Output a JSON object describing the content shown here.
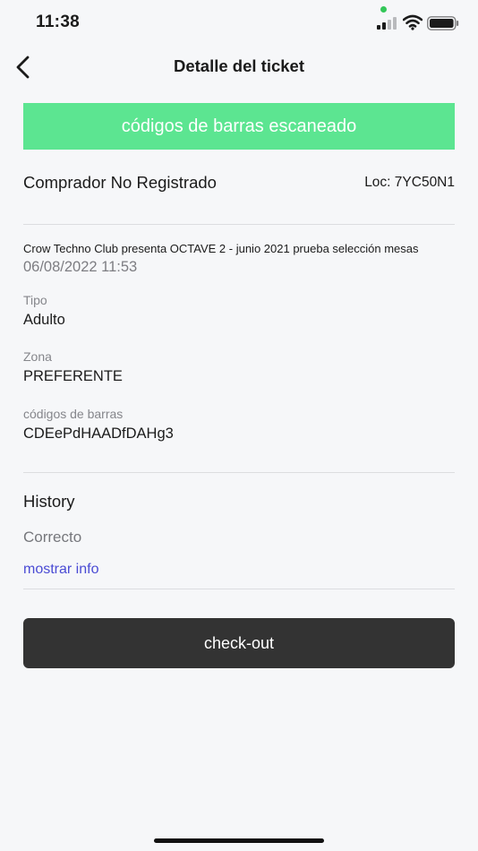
{
  "status_bar": {
    "time": "11:38",
    "icons": [
      "signal-icon",
      "wifi-icon",
      "battery-icon"
    ]
  },
  "header": {
    "title": "Detalle del ticket",
    "back_icon": "chevron-left-icon"
  },
  "banner": {
    "text": "códigos de barras escaneado",
    "color": "#5ce591"
  },
  "buyer": {
    "name": "Comprador No Registrado",
    "locator": "Loc: 7YC50N1"
  },
  "ticket": {
    "event": "Crow Techno Club presenta OCTAVE 2 - junio 2021 prueba selección mesas",
    "datetime": "06/08/2022 11:53",
    "type_label": "Tipo",
    "type_value": "Adulto",
    "zone_label": "Zona",
    "zone_value": "PREFERENTE",
    "barcode_label": "códigos de barras",
    "barcode_value": "CDEePdHAADfDAHg3"
  },
  "history": {
    "title": "History",
    "status": "Correcto",
    "more_link": "mostrar info",
    "link_color": "#4a4bd4"
  },
  "actions": {
    "checkout_label": "check-out",
    "checkout_color": "#333333"
  }
}
